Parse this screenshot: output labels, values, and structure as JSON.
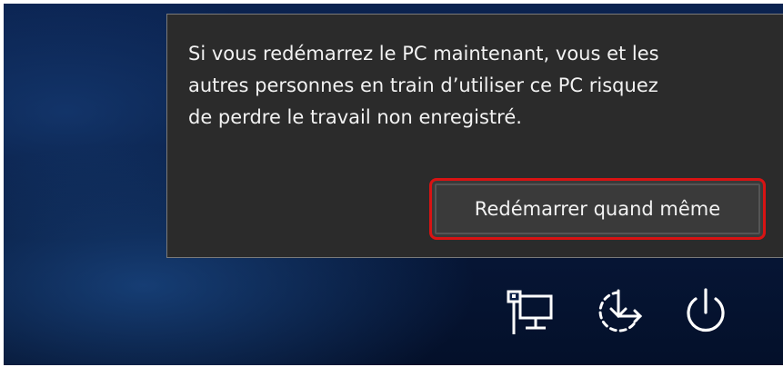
{
  "dialog": {
    "message": "Si vous redémarrez le PC maintenant, vous et les\nautres personnes en train d’utiliser ce PC risquez\nde perdre le travail non enregistré.",
    "restart_button_label": "Redémarrer quand même",
    "highlight_color": "#d81313"
  },
  "bottom_icons": [
    "network-icon",
    "accessibility-icon",
    "power-icon"
  ]
}
